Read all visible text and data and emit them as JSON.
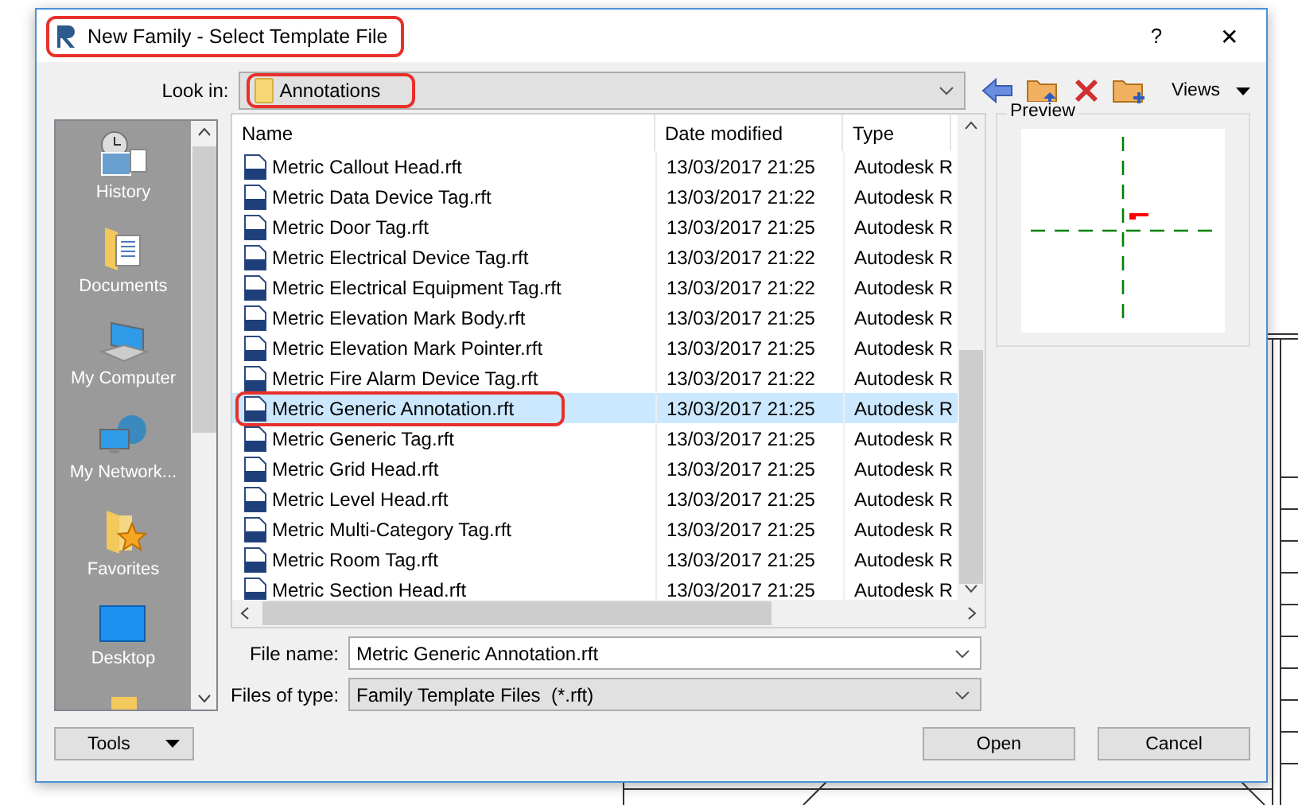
{
  "window": {
    "title": "New Family - Select Template File",
    "title_highlighted": true,
    "help": "?",
    "close": "✕"
  },
  "look_in": {
    "label": "Look in:",
    "value": "Annotations",
    "highlighted": true
  },
  "toolbar": {
    "views": "Views"
  },
  "places": [
    {
      "label": "History",
      "kind": "history"
    },
    {
      "label": "Documents",
      "kind": "documents"
    },
    {
      "label": "My Computer",
      "kind": "computer"
    },
    {
      "label": "My Network...",
      "kind": "network"
    },
    {
      "label": "Favorites",
      "kind": "favorites"
    },
    {
      "label": "Desktop",
      "kind": "desktop"
    }
  ],
  "table": {
    "columns": [
      "Name",
      "Date modified",
      "Type"
    ],
    "rows": [
      {
        "name": "Metric Callout Head.rft",
        "date": "13/03/2017 21:25",
        "type": "Autodesk R",
        "selected": false,
        "highlighted": false
      },
      {
        "name": "Metric Data Device Tag.rft",
        "date": "13/03/2017 21:22",
        "type": "Autodesk R",
        "selected": false,
        "highlighted": false
      },
      {
        "name": "Metric Door Tag.rft",
        "date": "13/03/2017 21:25",
        "type": "Autodesk R",
        "selected": false,
        "highlighted": false
      },
      {
        "name": "Metric Electrical Device Tag.rft",
        "date": "13/03/2017 21:22",
        "type": "Autodesk R",
        "selected": false,
        "highlighted": false
      },
      {
        "name": "Metric Electrical Equipment Tag.rft",
        "date": "13/03/2017 21:22",
        "type": "Autodesk R",
        "selected": false,
        "highlighted": false
      },
      {
        "name": "Metric Elevation Mark Body.rft",
        "date": "13/03/2017 21:25",
        "type": "Autodesk R",
        "selected": false,
        "highlighted": false
      },
      {
        "name": "Metric Elevation Mark Pointer.rft",
        "date": "13/03/2017 21:25",
        "type": "Autodesk R",
        "selected": false,
        "highlighted": false
      },
      {
        "name": "Metric Fire Alarm Device Tag.rft",
        "date": "13/03/2017 21:22",
        "type": "Autodesk R",
        "selected": false,
        "highlighted": false
      },
      {
        "name": "Metric Generic Annotation.rft",
        "date": "13/03/2017 21:25",
        "type": "Autodesk R",
        "selected": true,
        "highlighted": true
      },
      {
        "name": "Metric Generic Tag.rft",
        "date": "13/03/2017 21:25",
        "type": "Autodesk R",
        "selected": false,
        "highlighted": false
      },
      {
        "name": "Metric Grid Head.rft",
        "date": "13/03/2017 21:25",
        "type": "Autodesk R",
        "selected": false,
        "highlighted": false
      },
      {
        "name": "Metric Level Head.rft",
        "date": "13/03/2017 21:25",
        "type": "Autodesk R",
        "selected": false,
        "highlighted": false
      },
      {
        "name": "Metric Multi-Category Tag.rft",
        "date": "13/03/2017 21:25",
        "type": "Autodesk R",
        "selected": false,
        "highlighted": false
      },
      {
        "name": "Metric Room Tag.rft",
        "date": "13/03/2017 21:25",
        "type": "Autodesk R",
        "selected": false,
        "highlighted": false
      },
      {
        "name": "Metric Section Head.rft",
        "date": "13/03/2017 21:25",
        "type": "Autodesk R",
        "selected": false,
        "highlighted": false
      }
    ]
  },
  "preview": {
    "label": "Preview"
  },
  "file_name": {
    "label": "File name:",
    "value": "Metric Generic Annotation.rft"
  },
  "file_type": {
    "label": "Files of type:",
    "value": "Family Template Files  (*.rft)"
  },
  "buttons": {
    "tools": "Tools",
    "open": "Open",
    "cancel": "Cancel"
  }
}
